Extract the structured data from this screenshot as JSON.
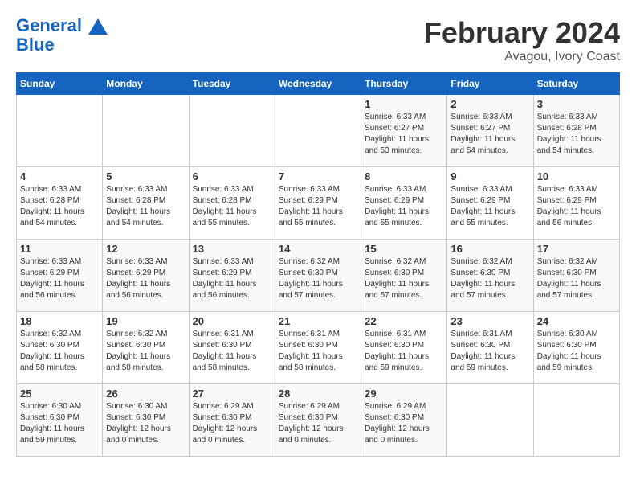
{
  "header": {
    "logo_line1": "General",
    "logo_line2": "Blue",
    "month_year": "February 2024",
    "location": "Avagou, Ivory Coast"
  },
  "days_of_week": [
    "Sunday",
    "Monday",
    "Tuesday",
    "Wednesday",
    "Thursday",
    "Friday",
    "Saturday"
  ],
  "weeks": [
    [
      {
        "day": "",
        "info": ""
      },
      {
        "day": "",
        "info": ""
      },
      {
        "day": "",
        "info": ""
      },
      {
        "day": "",
        "info": ""
      },
      {
        "day": "1",
        "info": "Sunrise: 6:33 AM\nSunset: 6:27 PM\nDaylight: 11 hours\nand 53 minutes."
      },
      {
        "day": "2",
        "info": "Sunrise: 6:33 AM\nSunset: 6:27 PM\nDaylight: 11 hours\nand 54 minutes."
      },
      {
        "day": "3",
        "info": "Sunrise: 6:33 AM\nSunset: 6:28 PM\nDaylight: 11 hours\nand 54 minutes."
      }
    ],
    [
      {
        "day": "4",
        "info": "Sunrise: 6:33 AM\nSunset: 6:28 PM\nDaylight: 11 hours\nand 54 minutes."
      },
      {
        "day": "5",
        "info": "Sunrise: 6:33 AM\nSunset: 6:28 PM\nDaylight: 11 hours\nand 54 minutes."
      },
      {
        "day": "6",
        "info": "Sunrise: 6:33 AM\nSunset: 6:28 PM\nDaylight: 11 hours\nand 55 minutes."
      },
      {
        "day": "7",
        "info": "Sunrise: 6:33 AM\nSunset: 6:29 PM\nDaylight: 11 hours\nand 55 minutes."
      },
      {
        "day": "8",
        "info": "Sunrise: 6:33 AM\nSunset: 6:29 PM\nDaylight: 11 hours\nand 55 minutes."
      },
      {
        "day": "9",
        "info": "Sunrise: 6:33 AM\nSunset: 6:29 PM\nDaylight: 11 hours\nand 55 minutes."
      },
      {
        "day": "10",
        "info": "Sunrise: 6:33 AM\nSunset: 6:29 PM\nDaylight: 11 hours\nand 56 minutes."
      }
    ],
    [
      {
        "day": "11",
        "info": "Sunrise: 6:33 AM\nSunset: 6:29 PM\nDaylight: 11 hours\nand 56 minutes."
      },
      {
        "day": "12",
        "info": "Sunrise: 6:33 AM\nSunset: 6:29 PM\nDaylight: 11 hours\nand 56 minutes."
      },
      {
        "day": "13",
        "info": "Sunrise: 6:33 AM\nSunset: 6:29 PM\nDaylight: 11 hours\nand 56 minutes."
      },
      {
        "day": "14",
        "info": "Sunrise: 6:32 AM\nSunset: 6:30 PM\nDaylight: 11 hours\nand 57 minutes."
      },
      {
        "day": "15",
        "info": "Sunrise: 6:32 AM\nSunset: 6:30 PM\nDaylight: 11 hours\nand 57 minutes."
      },
      {
        "day": "16",
        "info": "Sunrise: 6:32 AM\nSunset: 6:30 PM\nDaylight: 11 hours\nand 57 minutes."
      },
      {
        "day": "17",
        "info": "Sunrise: 6:32 AM\nSunset: 6:30 PM\nDaylight: 11 hours\nand 57 minutes."
      }
    ],
    [
      {
        "day": "18",
        "info": "Sunrise: 6:32 AM\nSunset: 6:30 PM\nDaylight: 11 hours\nand 58 minutes."
      },
      {
        "day": "19",
        "info": "Sunrise: 6:32 AM\nSunset: 6:30 PM\nDaylight: 11 hours\nand 58 minutes."
      },
      {
        "day": "20",
        "info": "Sunrise: 6:31 AM\nSunset: 6:30 PM\nDaylight: 11 hours\nand 58 minutes."
      },
      {
        "day": "21",
        "info": "Sunrise: 6:31 AM\nSunset: 6:30 PM\nDaylight: 11 hours\nand 58 minutes."
      },
      {
        "day": "22",
        "info": "Sunrise: 6:31 AM\nSunset: 6:30 PM\nDaylight: 11 hours\nand 59 minutes."
      },
      {
        "day": "23",
        "info": "Sunrise: 6:31 AM\nSunset: 6:30 PM\nDaylight: 11 hours\nand 59 minutes."
      },
      {
        "day": "24",
        "info": "Sunrise: 6:30 AM\nSunset: 6:30 PM\nDaylight: 11 hours\nand 59 minutes."
      }
    ],
    [
      {
        "day": "25",
        "info": "Sunrise: 6:30 AM\nSunset: 6:30 PM\nDaylight: 11 hours\nand 59 minutes."
      },
      {
        "day": "26",
        "info": "Sunrise: 6:30 AM\nSunset: 6:30 PM\nDaylight: 12 hours\nand 0 minutes."
      },
      {
        "day": "27",
        "info": "Sunrise: 6:29 AM\nSunset: 6:30 PM\nDaylight: 12 hours\nand 0 minutes."
      },
      {
        "day": "28",
        "info": "Sunrise: 6:29 AM\nSunset: 6:30 PM\nDaylight: 12 hours\nand 0 minutes."
      },
      {
        "day": "29",
        "info": "Sunrise: 6:29 AM\nSunset: 6:30 PM\nDaylight: 12 hours\nand 0 minutes."
      },
      {
        "day": "",
        "info": ""
      },
      {
        "day": "",
        "info": ""
      }
    ]
  ]
}
